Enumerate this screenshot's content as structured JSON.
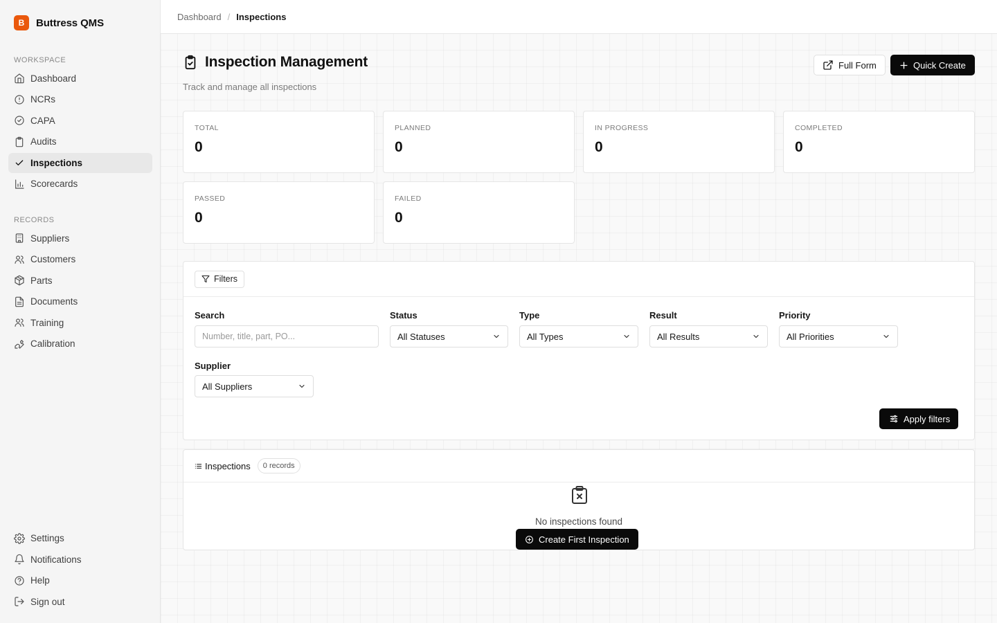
{
  "app": {
    "name": "Buttress QMS",
    "logo_letter": "B",
    "brand_color": "#ea580c"
  },
  "sidebar": {
    "workspace_label": "WORKSPACE",
    "workspace_items": [
      {
        "label": "Dashboard",
        "icon": "home-icon"
      },
      {
        "label": "NCRs",
        "icon": "alert-circle-icon"
      },
      {
        "label": "CAPA",
        "icon": "check-circle-icon"
      },
      {
        "label": "Audits",
        "icon": "clipboard-icon"
      },
      {
        "label": "Inspections",
        "icon": "check-icon",
        "active": true
      },
      {
        "label": "Scorecards",
        "icon": "bar-chart-icon"
      }
    ],
    "records_label": "RECORDS",
    "records_items": [
      {
        "label": "Suppliers",
        "icon": "building-icon"
      },
      {
        "label": "Customers",
        "icon": "users-icon"
      },
      {
        "label": "Parts",
        "icon": "package-icon"
      },
      {
        "label": "Documents",
        "icon": "file-text-icon"
      },
      {
        "label": "Training",
        "icon": "users-icon"
      },
      {
        "label": "Calibration",
        "icon": "wrench-icon"
      }
    ],
    "footer_items": [
      {
        "label": "Settings",
        "icon": "gear-icon"
      },
      {
        "label": "Notifications",
        "icon": "bell-icon"
      },
      {
        "label": "Help",
        "icon": "help-circle-icon"
      },
      {
        "label": "Sign out",
        "icon": "log-out-icon"
      }
    ]
  },
  "breadcrumb": {
    "parent": "Dashboard",
    "separator": "/",
    "current": "Inspections"
  },
  "header": {
    "title": "Inspection Management",
    "subtitle": "Track and manage all inspections",
    "full_form_label": "Full Form",
    "quick_create_label": "Quick Create"
  },
  "stats": [
    {
      "label": "TOTAL",
      "value": "0"
    },
    {
      "label": "PLANNED",
      "value": "0"
    },
    {
      "label": "IN PROGRESS",
      "value": "0"
    },
    {
      "label": "COMPLETED",
      "value": "0"
    },
    {
      "label": "PASSED",
      "value": "0"
    },
    {
      "label": "FAILED",
      "value": "0"
    }
  ],
  "filters": {
    "button_label": "Filters",
    "search_label": "Search",
    "search_placeholder": "Number, title, part, PO...",
    "search_value": "",
    "status_label": "Status",
    "status_value": "All Statuses",
    "type_label": "Type",
    "type_value": "All Types",
    "result_label": "Result",
    "result_value": "All Results",
    "priority_label": "Priority",
    "priority_value": "All Priorities",
    "supplier_label": "Supplier",
    "supplier_value": "All Suppliers",
    "apply_label": "Apply filters"
  },
  "table": {
    "title": "Inspections",
    "records_badge": "0 records",
    "empty_text": "No inspections found",
    "create_label": "Create First Inspection"
  }
}
